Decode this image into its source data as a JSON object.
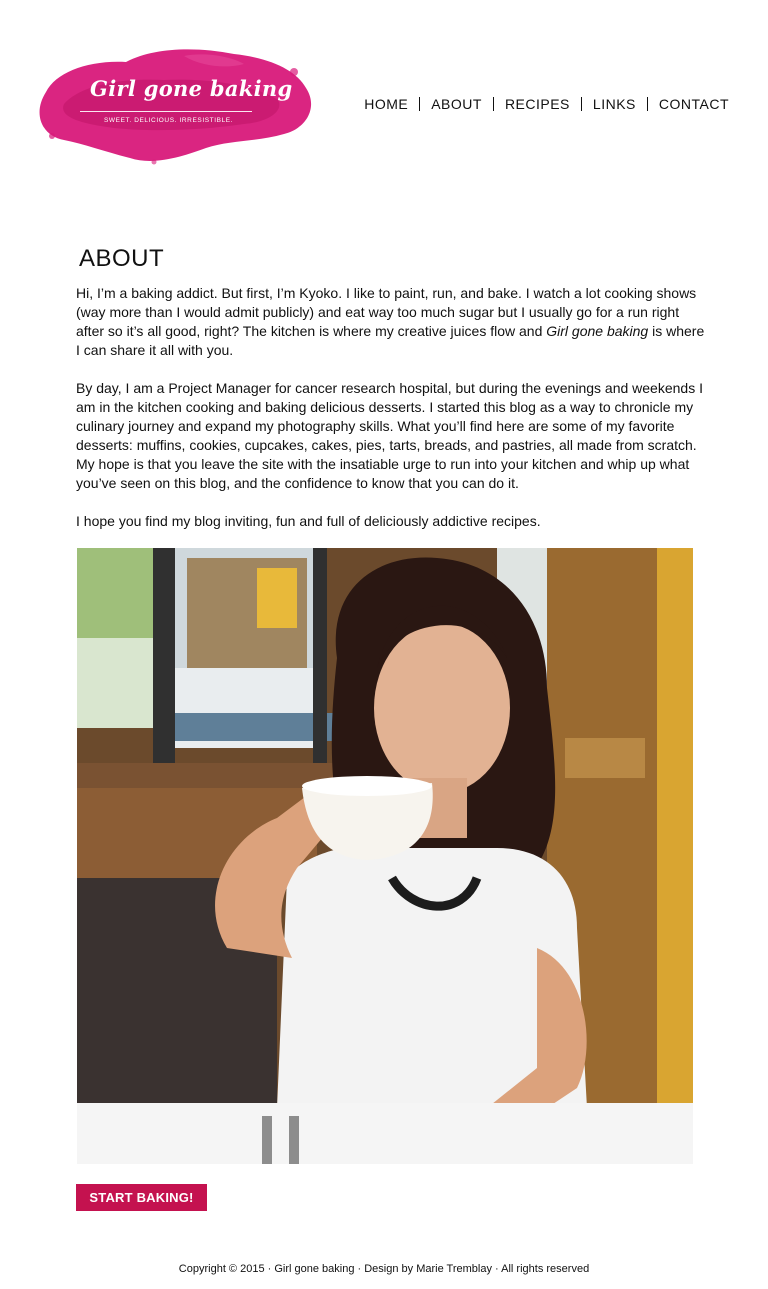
{
  "logo": {
    "title": "Girl gone baking",
    "tagline": "SWEET. DELICIOUS. IRRESISTIBLE.",
    "color": "#d8197a"
  },
  "nav": {
    "items": [
      "HOME",
      "ABOUT",
      "RECIPES",
      "LINKS",
      "CONTACT"
    ]
  },
  "main": {
    "title": "ABOUT",
    "para1_before": "Hi, I’m a baking addict. But first, I’m Kyoko. I like to paint, run, and bake. I watch a lot cooking shows (way more than I would admit publicly) and eat way too much sugar but I usually go for a run right after so it’s all good, right? The kitchen is where my creative juices flow and ",
    "para1_em": "Girl gone baking",
    "para1_after": " is where I can share it all with you.",
    "para2": "By day, I am a Project Manager for cancer research hospital, but during the evenings and weekends I am in the kitchen cooking and baking delicious desserts. I started this blog as a way to chronicle my culinary journey and expand my photography skills. What you’ll find here are some of my favorite desserts: muffins, cookies, cupcakes, cakes, pies, tarts, breads, and pastries, all made from scratch. My hope is that you leave the site with the insatiable urge to run into your kitchen and whip up what you’ve seen on this blog, and the confidence to know that you can do it.",
    "para3": "I hope you find my blog inviting, fun and full of deliciously addictive recipes.",
    "cta_label": "START BAKING!"
  },
  "footer": {
    "text": "Copyright © 2015 · Girl gone baking · Design by Marie Tremblay · All rights reserved"
  },
  "colors": {
    "accent": "#c4124f",
    "text": "#111111"
  }
}
